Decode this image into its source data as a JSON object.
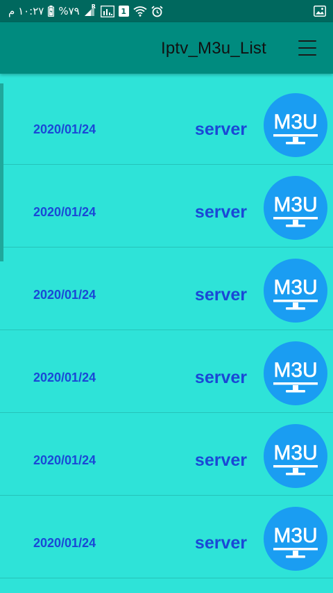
{
  "status_bar": {
    "time": "١٠:٢٧ م",
    "battery": "%٧٩",
    "signal_badge": "R",
    "sim_badge": "1"
  },
  "app_bar": {
    "title": "Iptv_M3u_List",
    "menu_icon": "hamburger-menu-icon"
  },
  "items": [
    {
      "name": "server",
      "date": "2020/01/24",
      "logo_text": "M3U"
    },
    {
      "name": "server",
      "date": "2020/01/24",
      "logo_text": "M3U"
    },
    {
      "name": "server",
      "date": "2020/01/24",
      "logo_text": "M3U"
    },
    {
      "name": "server",
      "date": "2020/01/24",
      "logo_text": "M3U"
    },
    {
      "name": "server",
      "date": "2020/01/24",
      "logo_text": "M3U"
    },
    {
      "name": "server",
      "date": "2020/01/24",
      "logo_text": "M3U"
    }
  ],
  "colors": {
    "status_bar": "#00685e",
    "app_bar": "#008b7f",
    "background": "#2ee3d8",
    "text_accent": "#1a48d6",
    "logo_blue": "#1a9df2"
  }
}
